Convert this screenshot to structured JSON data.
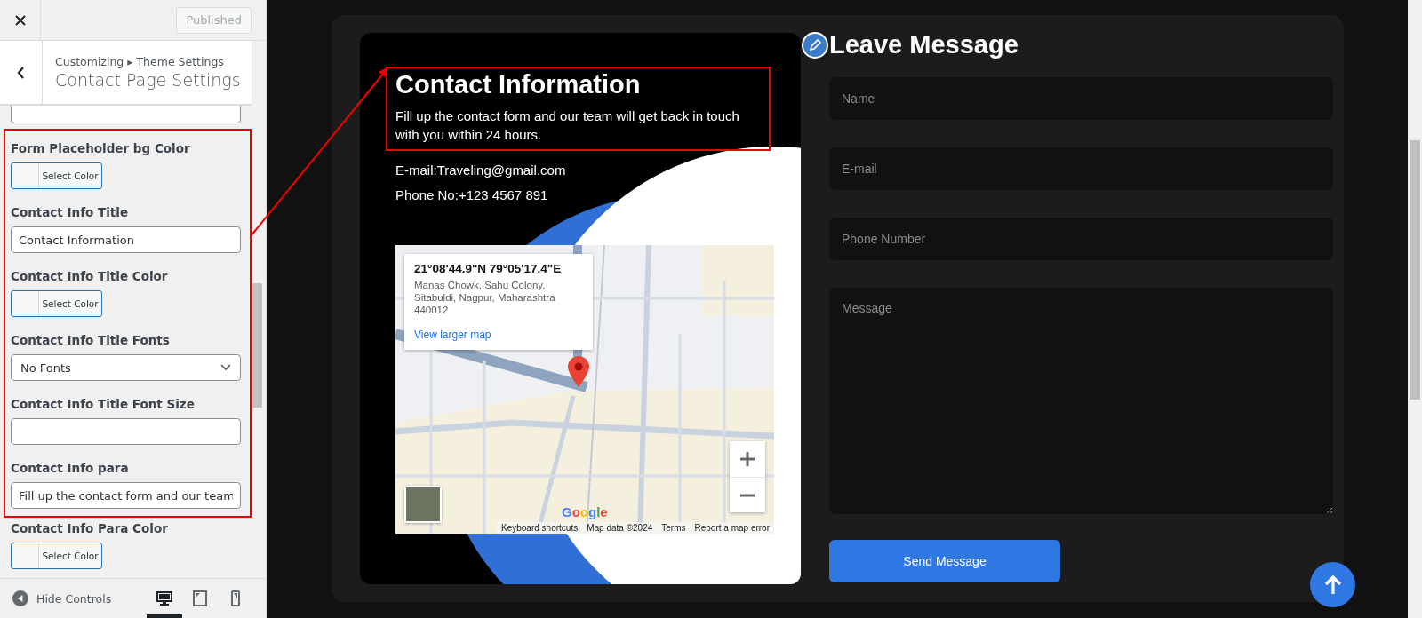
{
  "customizer": {
    "publish_button": "Published",
    "breadcrumb": "Customizing ▸ Theme Settings",
    "section_title": "Contact Page Settings",
    "controls_before": [
      {
        "kind": "text"
      }
    ],
    "highlighted_controls": [
      {
        "kind": "color",
        "label": "Form Placeholder bg Color",
        "button": "Select Color"
      },
      {
        "kind": "text",
        "label": "Contact Info Title",
        "value": "Contact Information"
      },
      {
        "kind": "color",
        "label": "Contact Info Title Color",
        "button": "Select Color"
      },
      {
        "kind": "select",
        "label": "Contact Info Title Fonts",
        "value": "No Fonts"
      },
      {
        "kind": "text",
        "label": "Contact Info Title Font Size"
      },
      {
        "kind": "text",
        "label": "Contact Info para",
        "value": "Fill up the contact form and our team"
      }
    ],
    "controls_after": [
      {
        "kind": "color",
        "label": "Contact Info Para Color",
        "button": "Select Color"
      }
    ],
    "hide_controls": "Hide Controls",
    "devices": [
      {
        "kind": "desktop",
        "selected": true
      },
      {
        "kind": "tablet",
        "selected": false
      },
      {
        "kind": "mobile",
        "selected": false
      }
    ]
  },
  "contact_info": {
    "title": "Contact Information",
    "para": "Fill up the contact form and our team will get back in touch with you within 24 hours.",
    "email_label": "E-mail:",
    "email": "Traveling@gmail.com",
    "phone_label": "Phone No:",
    "phone": "+123 4567 891"
  },
  "map": {
    "coordinates": "21°08'44.9\"N 79°05'17.4\"E",
    "address": "Manas Chowk, Sahu Colony, Sitabuldi, Nagpur, Maharashtra 440012",
    "link": "View larger map",
    "logo": "Google",
    "footer": [
      "Keyboard shortcuts",
      "Map data ©2024",
      "Terms",
      "Report a map error"
    ]
  },
  "form": {
    "title": "Leave Message",
    "fields": [
      {
        "kind": "input",
        "placeholder": "Name"
      },
      {
        "kind": "input",
        "placeholder": "E-mail"
      },
      {
        "kind": "input",
        "placeholder": "Phone Number"
      },
      {
        "kind": "textarea",
        "placeholder": "Message"
      }
    ],
    "submit": "Send Message"
  }
}
